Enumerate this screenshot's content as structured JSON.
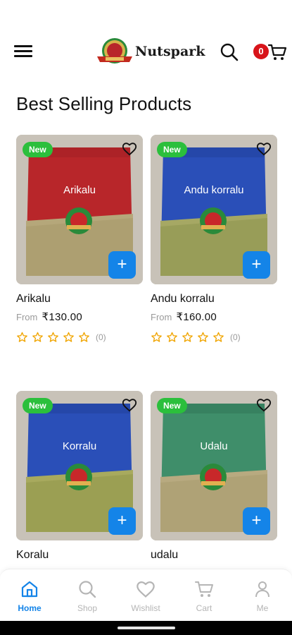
{
  "header": {
    "brand_name": "Nutspark",
    "cart_count": "0"
  },
  "section": {
    "title": "Best Selling Products"
  },
  "products": [
    {
      "name": "Arikalu",
      "badge": "New",
      "from_label": "From",
      "price": "₹130.00",
      "rating_count": "(0)",
      "pouch_label": "Arikalu",
      "pouch_color": "#b8262a"
    },
    {
      "name": "Andu korralu",
      "badge": "New",
      "from_label": "From",
      "price": "₹160.00",
      "rating_count": "(0)",
      "pouch_label": "Andu korralu",
      "pouch_color": "#2a4fb8"
    },
    {
      "name": "Koralu",
      "badge": "New",
      "pouch_label": "Korralu",
      "pouch_color": "#2a4fb8"
    },
    {
      "name": "udalu",
      "badge": "New",
      "pouch_label": "Udalu",
      "pouch_color": "#3f8e6a"
    }
  ],
  "bottom_nav": {
    "items": [
      {
        "label": "Home",
        "icon": "home-icon"
      },
      {
        "label": "Shop",
        "icon": "search-icon"
      },
      {
        "label": "Wishlist",
        "icon": "heart-icon"
      },
      {
        "label": "Cart",
        "icon": "cart-icon"
      },
      {
        "label": "Me",
        "icon": "user-icon"
      }
    ]
  },
  "colors": {
    "accent": "#1484e8",
    "badge_new": "#2bbf3c",
    "cart_badge": "#d8141a",
    "star": "#f0a400"
  }
}
